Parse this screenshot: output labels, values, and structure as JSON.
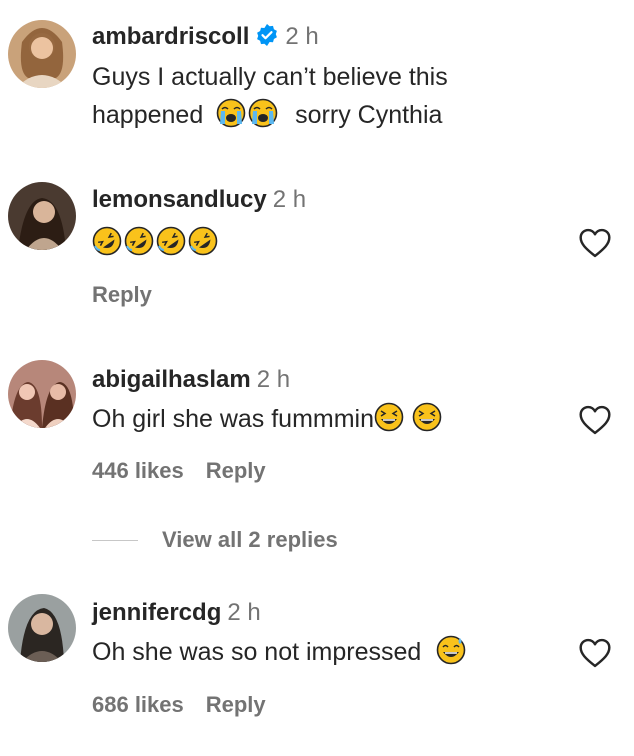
{
  "comments": [
    {
      "username": "ambardriscoll",
      "verified": true,
      "time": "2 h",
      "text_line1": "Guys I actually can’t believe this",
      "text_line2_before": "happened",
      "text_line2_after": "sorry Cynthia"
    },
    {
      "username": "lemonsandlucy",
      "time": "2 h",
      "reply_label": "Reply"
    },
    {
      "username": "abigailhaslam",
      "time": "2 h",
      "text": "Oh girl she was fummmin",
      "likes": "446 likes",
      "reply_label": "Reply",
      "view_replies": "View all 2 replies"
    },
    {
      "username": "jennifercdg",
      "time": "2 h",
      "text": "Oh she was so not impressed",
      "likes": "686 likes",
      "reply_label": "Reply"
    }
  ],
  "icons": {
    "verified": "verified-badge-icon",
    "heart": "heart-outline-icon",
    "emoji_crying": "loudly-crying-face-emoji",
    "emoji_rofl": "rolling-on-floor-laughing-emoji",
    "emoji_grin": "grinning-squinting-face-emoji",
    "emoji_sweat": "grinning-face-with-sweat-emoji"
  },
  "colors": {
    "verified_blue": "#0095f6",
    "text": "#262626",
    "secondary": "#737373",
    "emoji_yellow": "#f9c21b"
  }
}
